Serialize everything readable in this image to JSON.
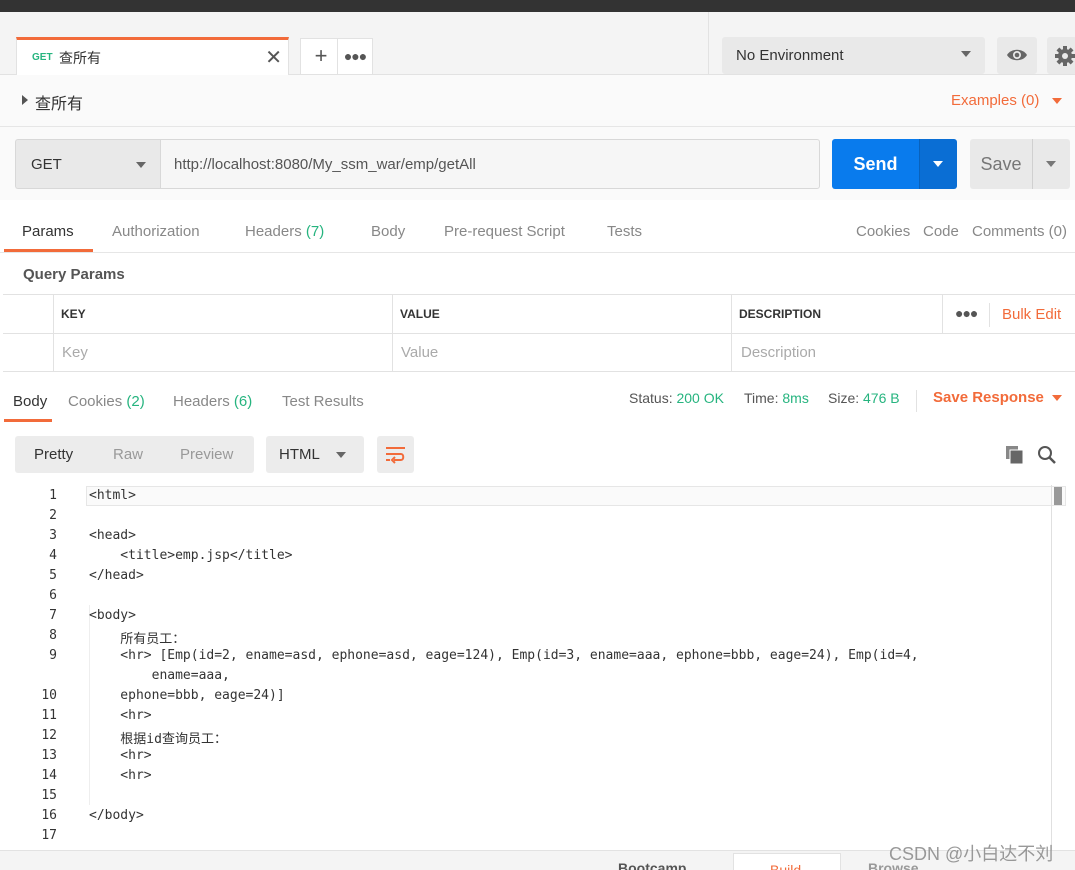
{
  "header": {
    "request_tab": {
      "method": "GET",
      "name": "查所有"
    },
    "environment": "No Environment"
  },
  "request": {
    "title": "查所有",
    "examples_label": "Examples (0)",
    "method": "GET",
    "url": "http://localhost:8080/My_ssm_war/emp/getAll",
    "send_label": "Send",
    "save_label": "Save"
  },
  "request_tabs": {
    "params": "Params",
    "authorization": "Authorization",
    "headers": "Headers",
    "headers_count": "(7)",
    "body": "Body",
    "prerequest": "Pre-request Script",
    "tests": "Tests",
    "cookies": "Cookies",
    "code": "Code",
    "comments": "Comments (0)"
  },
  "query_params": {
    "title": "Query Params",
    "columns": [
      "KEY",
      "VALUE",
      "DESCRIPTION"
    ],
    "placeholders": [
      "Key",
      "Value",
      "Description"
    ],
    "bulk_edit": "Bulk Edit"
  },
  "response": {
    "tabs": {
      "body": "Body",
      "cookies": "Cookies",
      "cookies_count": "(2)",
      "headers": "Headers",
      "headers_count": "(6)",
      "test_results": "Test Results"
    },
    "status_label": "Status:",
    "status": "200 OK",
    "time_label": "Time:",
    "time": "8ms",
    "size_label": "Size:",
    "size": "476 B",
    "save_response": "Save Response",
    "views": [
      "Pretty",
      "Raw",
      "Preview"
    ],
    "format": "HTML",
    "lines": [
      {
        "n": "1",
        "t": "<html>"
      },
      {
        "n": "2",
        "t": ""
      },
      {
        "n": "3",
        "t": "<head>"
      },
      {
        "n": "4",
        "t": "    <title>emp.jsp</title>"
      },
      {
        "n": "5",
        "t": "</head>"
      },
      {
        "n": "6",
        "t": ""
      },
      {
        "n": "7",
        "t": "<body>"
      },
      {
        "n": "8",
        "t": "    所有员工："
      },
      {
        "n": "9",
        "t": "    <hr> [Emp(id=2, ename=asd, ephone=asd, eage=124), Emp(id=3, ename=aaa, ephone=bbb, eage=24), Emp(id=4,"
      },
      {
        "n": "",
        "t": "        ename=aaa,"
      },
      {
        "n": "10",
        "t": "    ephone=bbb, eage=24)]"
      },
      {
        "n": "11",
        "t": "    <hr>"
      },
      {
        "n": "12",
        "t": "    根据id查询员工："
      },
      {
        "n": "13",
        "t": "    <hr>"
      },
      {
        "n": "14",
        "t": "    <hr>"
      },
      {
        "n": "15",
        "t": ""
      },
      {
        "n": "16",
        "t": "</body>"
      },
      {
        "n": "17",
        "t": ""
      }
    ]
  },
  "footer": {
    "bootcamp": "Bootcamp",
    "build": "Build",
    "browse": "Browse"
  },
  "watermark": "CSDN @小白达不刘",
  "colors": {
    "accent": "#f26b3a",
    "send": "#097bed",
    "success": "#26b47f"
  }
}
